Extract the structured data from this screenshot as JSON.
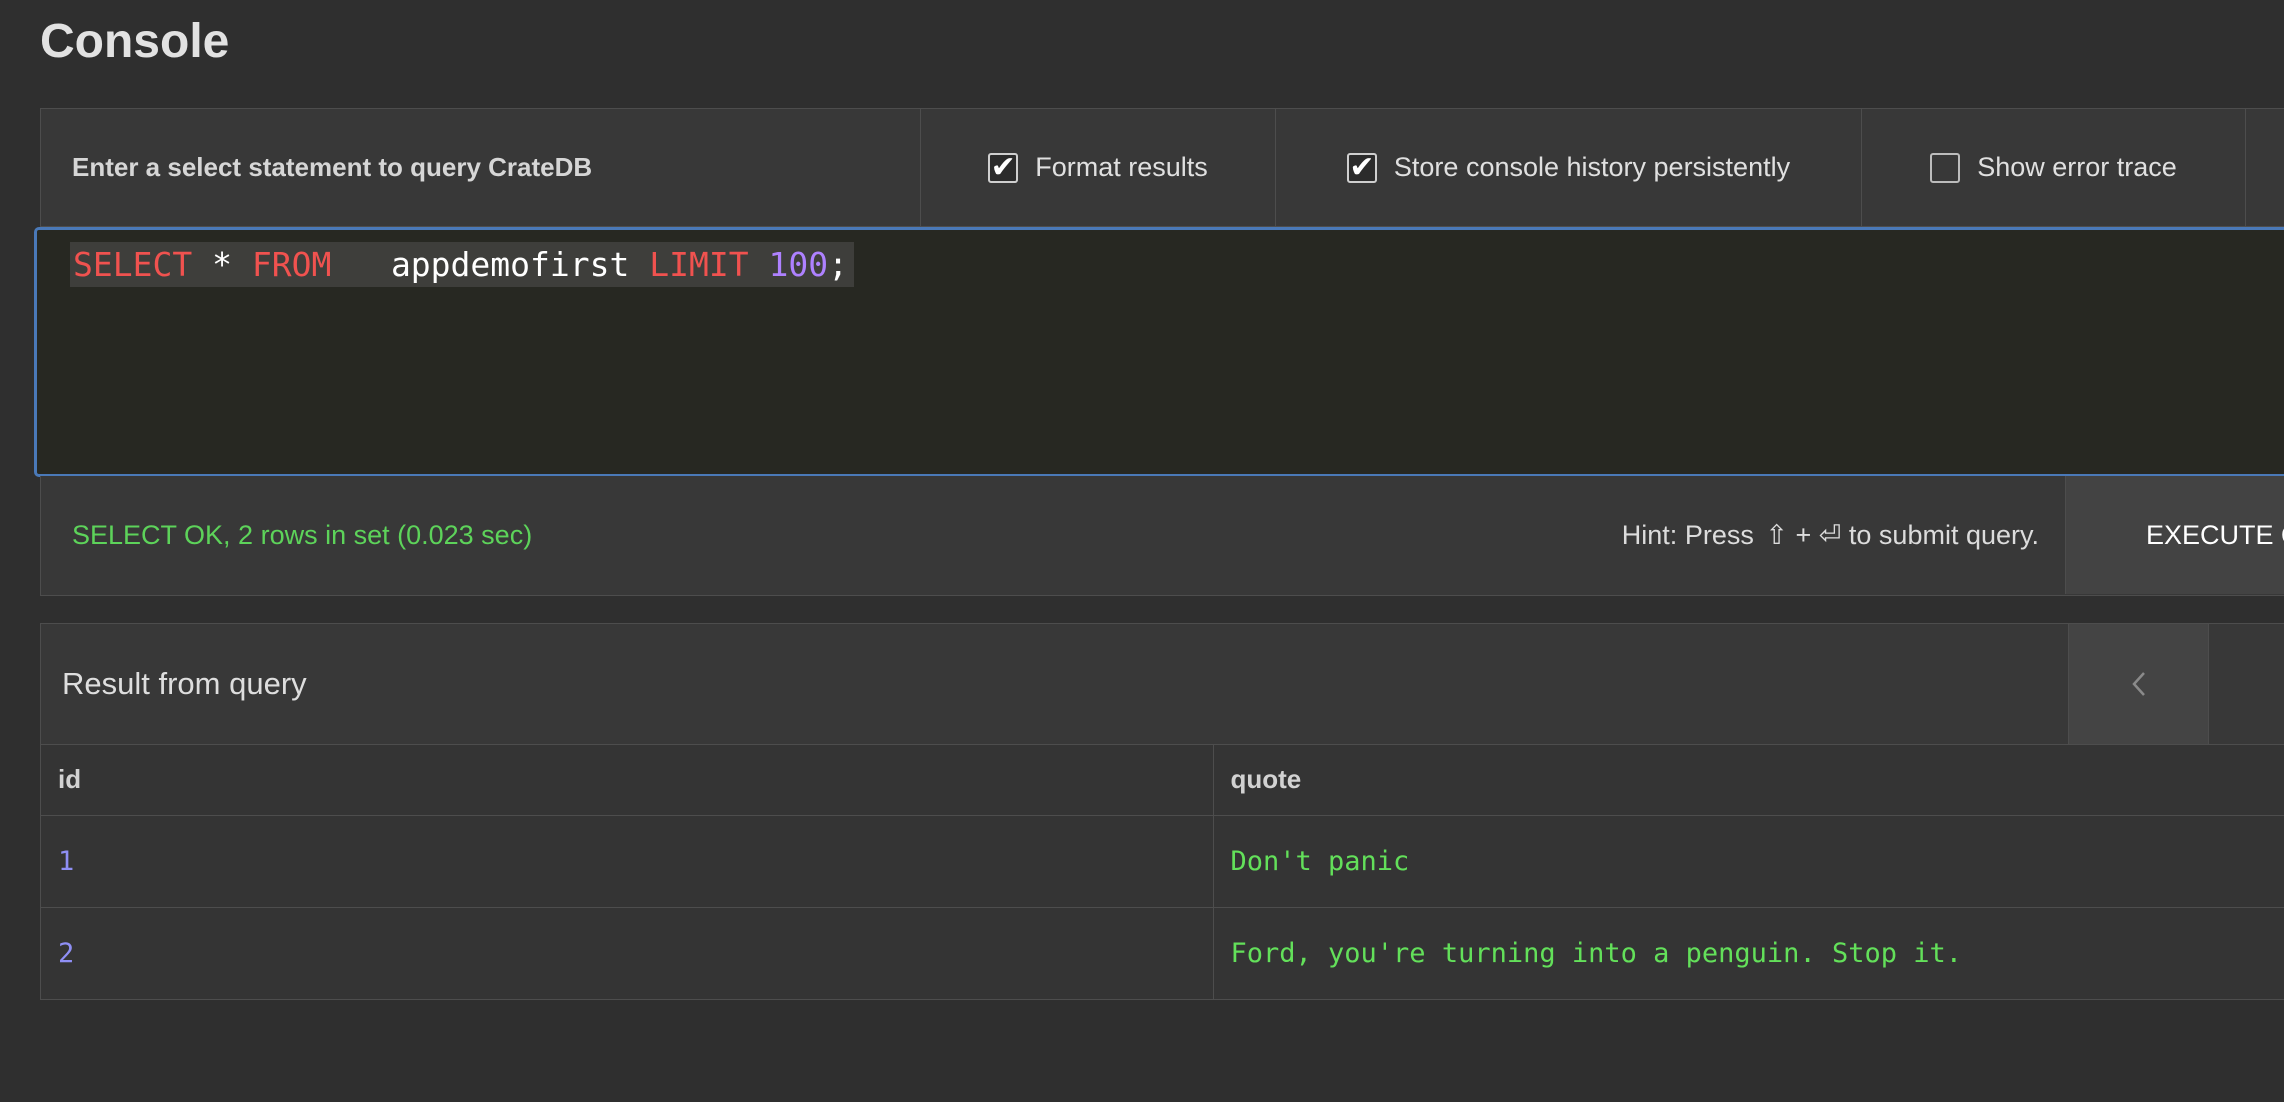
{
  "page": {
    "title": "Console"
  },
  "toolbar": {
    "prompt": "Enter a select statement to query CrateDB",
    "options": [
      {
        "label": "Format results",
        "checked": true
      },
      {
        "label": "Store console history persistently",
        "checked": true
      },
      {
        "label": "Show error trace",
        "checked": false
      }
    ]
  },
  "editor": {
    "tokens": {
      "select": "SELECT",
      "star": "*",
      "from": "FROM",
      "table": "appdemofirst",
      "limit": "LIMIT",
      "limit_value": "100",
      "terminator": ";"
    }
  },
  "status": {
    "message": "SELECT OK, 2 rows in set (0.023 sec)",
    "hint_prefix": "Hint: Press",
    "hint_keys": "⇧ + ⏎",
    "hint_suffix": "to submit query.",
    "execute_label": "EXECUTE QUERY"
  },
  "result": {
    "title": "Result from query",
    "columns": [
      "id",
      "quote"
    ],
    "rows": [
      {
        "id": "1",
        "quote": "Don't panic"
      },
      {
        "id": "2",
        "quote": "Ford, you're turning into a penguin. Stop it."
      }
    ]
  },
  "colors": {
    "keyword": "#f0524f",
    "number": "#ae81ff",
    "status_ok": "#5dd35a",
    "editor_focus_border": "#4a79b8"
  },
  "icons": {
    "pager_prev": "chevron-left-icon",
    "checkbox_checked": "checkmark-icon"
  }
}
